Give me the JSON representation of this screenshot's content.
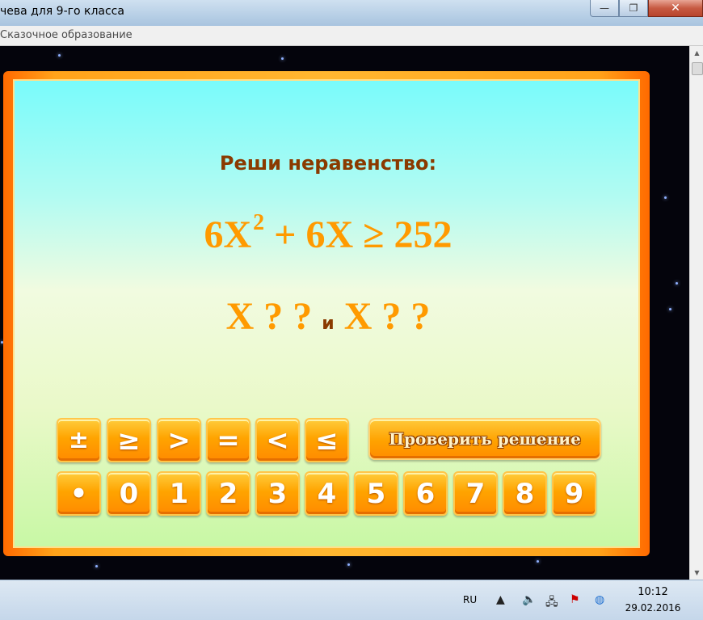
{
  "window": {
    "title": "чева для 9-го класса",
    "menu_text": "Сказочное образование",
    "minimize": "—",
    "maximize": "❐",
    "close": "✕"
  },
  "game": {
    "heading": "Реши неравенство:",
    "equation": {
      "coef1": "6X",
      "exponent": "2",
      "rest": "+ 6X  ≥  252"
    },
    "answer": {
      "left": "X  ?  ?",
      "conjunction": "и",
      "right": "X  ?  ?"
    },
    "sign_keys": [
      "±",
      "≥",
      ">",
      "=",
      "<",
      "≤"
    ],
    "digit_keys": [
      "•",
      "0",
      "1",
      "2",
      "3",
      "4",
      "5",
      "6",
      "7",
      "8",
      "9"
    ],
    "check_button": "Проверить решение"
  },
  "taskbar": {
    "language": "RU",
    "time": "10:12",
    "date": "29.02.2016"
  },
  "colors": {
    "accent_orange": "#ff9a00",
    "heading_brown": "#8a3a00",
    "frame_orange": "#ff6a00"
  }
}
